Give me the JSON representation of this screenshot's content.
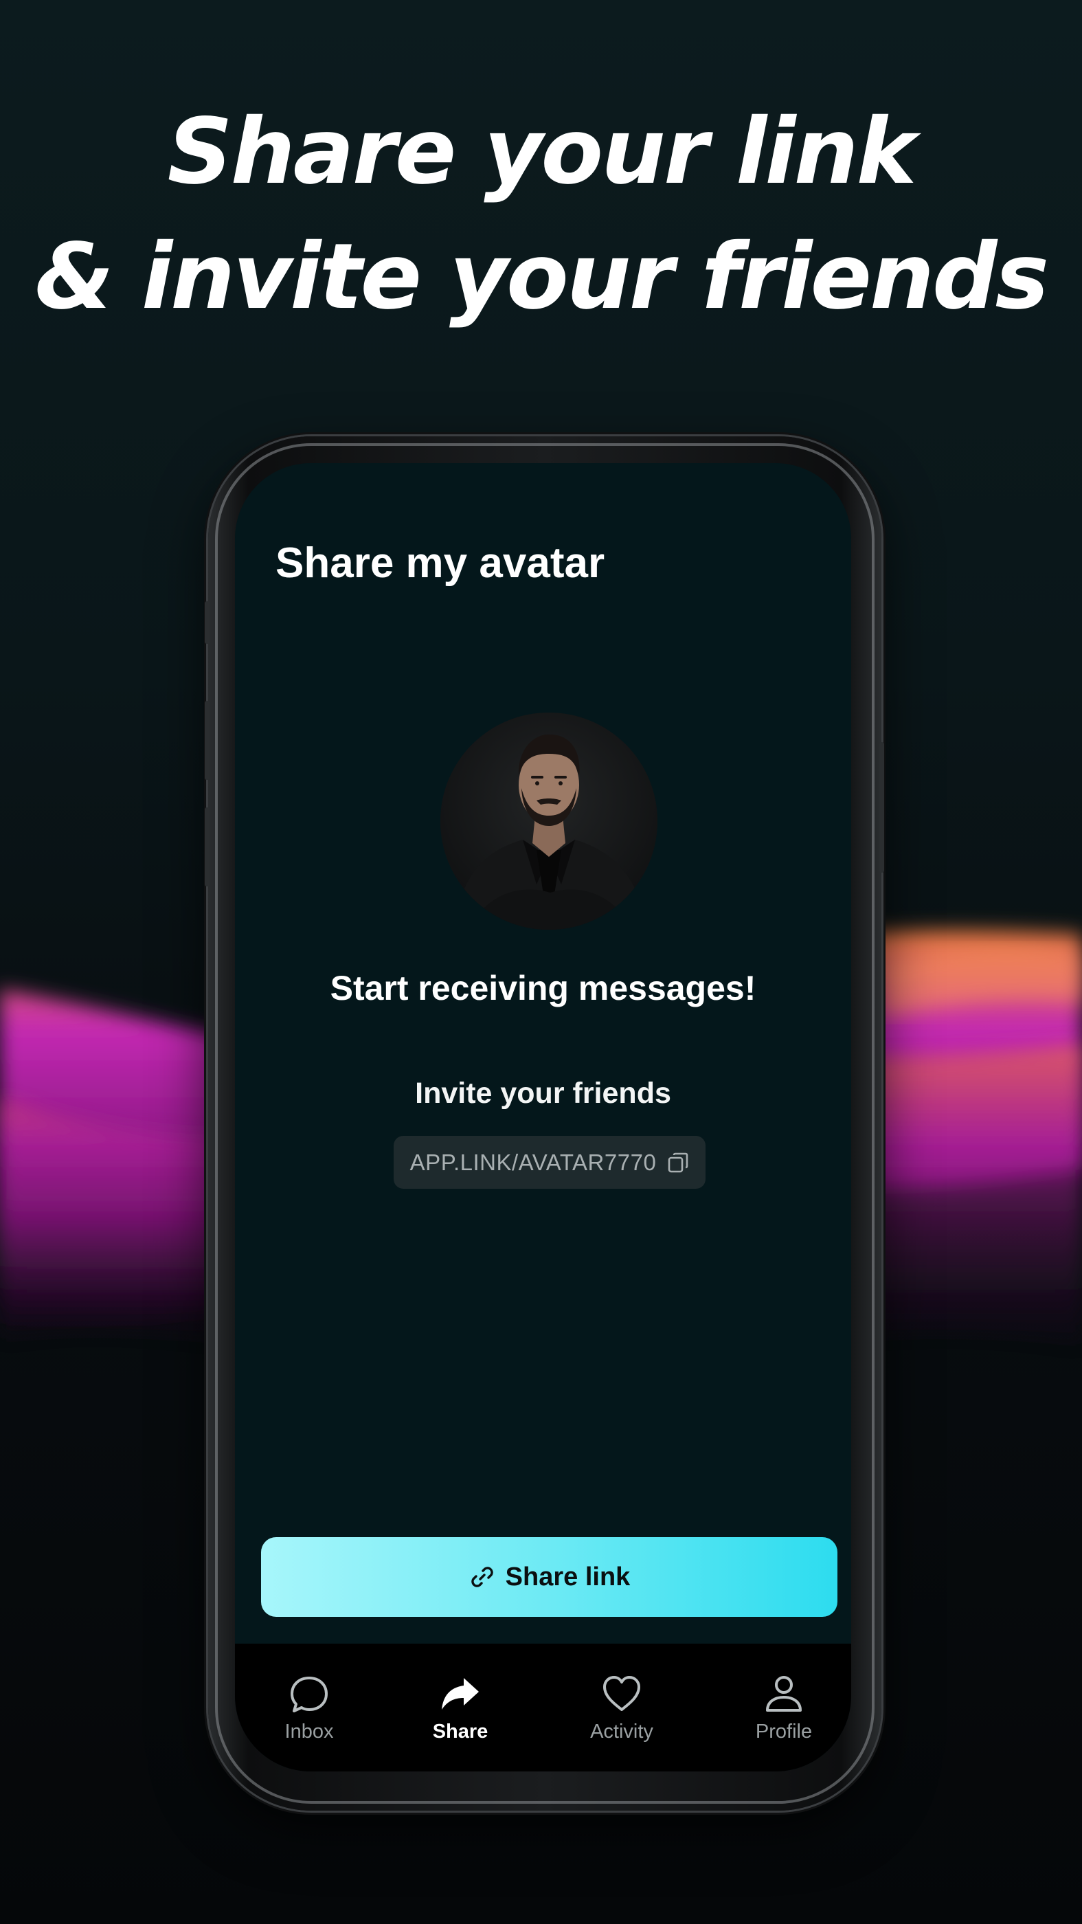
{
  "headline": {
    "line1": "Share your link",
    "line2": "& invite your friends"
  },
  "screen": {
    "title": "Share my avatar",
    "avatar_alt": "profile photo",
    "start_message": "Start receiving messages!",
    "invite_label": "Invite your friends",
    "link_text": "APP.LINK/AVATAR7770",
    "share_button_label": "Share link"
  },
  "tabbar": {
    "tabs": [
      {
        "label": "Inbox",
        "icon": "chat-bubble-icon",
        "active": false
      },
      {
        "label": "Share",
        "icon": "share-arrow-icon",
        "active": true
      },
      {
        "label": "Activity",
        "icon": "heart-icon",
        "active": false
      },
      {
        "label": "Profile",
        "icon": "person-icon",
        "active": false
      }
    ]
  },
  "colors": {
    "accent_gradient_start": "#a7f6fb",
    "accent_gradient_end": "#2ddcef",
    "screen_background": "#04171b",
    "wave_magenta": "#c020b0"
  }
}
